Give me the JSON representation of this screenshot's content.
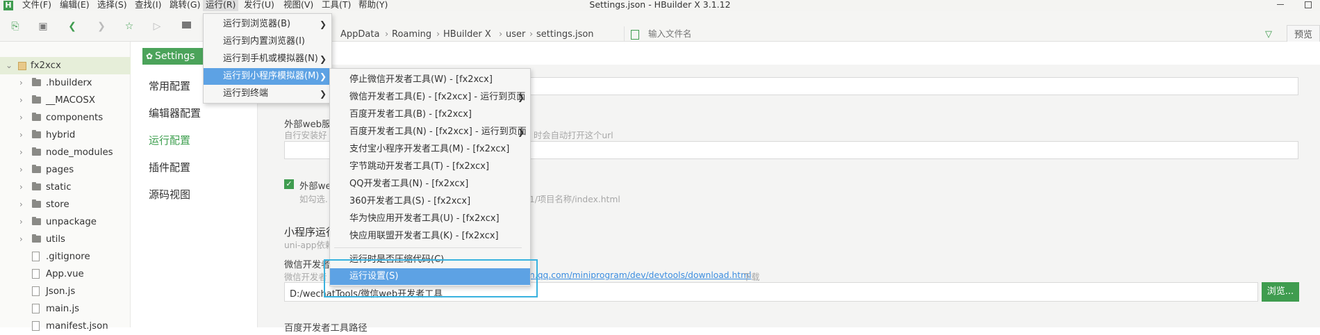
{
  "window": {
    "title": "Settings.json - HBuilder X 3.1.12",
    "app_icon": "H"
  },
  "menubar": [
    {
      "label": "文件(F)"
    },
    {
      "label": "编辑(E)"
    },
    {
      "label": "选择(S)"
    },
    {
      "label": "查找(I)"
    },
    {
      "label": "跳转(G)"
    },
    {
      "label": "运行(R)",
      "active": true
    },
    {
      "label": "发行(U)"
    },
    {
      "label": "视图(V)"
    },
    {
      "label": "工具(T)"
    },
    {
      "label": "帮助(Y)"
    }
  ],
  "window_controls": [
    "minimize-icon",
    "restore-icon"
  ],
  "toolbar": {
    "breadcrumb": [
      "AppData",
      "Roaming",
      "HBuilder X",
      "user",
      "settings.json"
    ],
    "file_search_placeholder": "输入文件名",
    "preview_label": "预览"
  },
  "sidebar": {
    "root": "fx2xcx",
    "items": [
      {
        "label": ".hbuilderx",
        "type": "folder"
      },
      {
        "label": "__MACOSX",
        "type": "folder"
      },
      {
        "label": "components",
        "type": "folder"
      },
      {
        "label": "hybrid",
        "type": "folder"
      },
      {
        "label": "node_modules",
        "type": "folder"
      },
      {
        "label": "pages",
        "type": "folder"
      },
      {
        "label": "static",
        "type": "folder"
      },
      {
        "label": "store",
        "type": "folder"
      },
      {
        "label": "unpackage",
        "type": "folder"
      },
      {
        "label": "utils",
        "type": "folder"
      },
      {
        "label": ".gitignore",
        "type": "file"
      },
      {
        "label": "App.vue",
        "type": "file"
      },
      {
        "label": "Json.js",
        "type": "file"
      },
      {
        "label": "main.js",
        "type": "file"
      },
      {
        "label": "manifest.json",
        "type": "file"
      }
    ]
  },
  "settings": {
    "tab_label": "Settings",
    "nav": [
      {
        "label": "常用配置"
      },
      {
        "label": "编辑器配置"
      },
      {
        "label": "运行配置",
        "active": true
      },
      {
        "label": "插件配置"
      },
      {
        "label": "源码视图"
      }
    ],
    "external_web_label": "外部web服务",
    "external_web_hint_left": "自行安装好",
    "external_web_hint_right": "时会自动打开这个url",
    "external_web_check_label": "外部we",
    "external_web_check_hint_left": "如勾选.",
    "external_web_check_hint_right": ".1/项目名称/index.html",
    "mp_section_title": "小程序运行",
    "mp_section_hint": "uni-app依赖",
    "wechat_label": "微信开发者",
    "wechat_hint_left": "微信开发者",
    "wechat_hint_link": "n.qq.com/miniprogram/dev/devtools/download.html",
    "wechat_hint_right": "下载",
    "wechat_path_value": "D:/wechatTools/微信web开发者工具",
    "browse_label": "浏览...",
    "baidu_label": "百度开发者工具路径"
  },
  "run_menu": [
    {
      "label": "运行到浏览器(B)",
      "submenu": true
    },
    {
      "label": "运行到内置浏览器(I)",
      "submenu": false
    },
    {
      "label": "运行到手机或模拟器(N)",
      "submenu": true
    },
    {
      "label": "运行到小程序模拟器(M)",
      "submenu": true,
      "highlighted": true
    },
    {
      "label": "运行到终端",
      "submenu": true
    }
  ],
  "mp_submenu": [
    {
      "label": "停止微信开发者工具(W) - [fx2xcx]",
      "submenu": false
    },
    {
      "label": "微信开发者工具(E) - [fx2xcx] - 运行到页面",
      "submenu": true
    },
    {
      "label": "百度开发者工具(B) - [fx2xcx]",
      "submenu": false
    },
    {
      "label": "百度开发者工具(N) - [fx2xcx] - 运行到页面",
      "submenu": true
    },
    {
      "label": "支付宝小程序开发者工具(M) - [fx2xcx]",
      "submenu": false
    },
    {
      "label": "字节跳动开发者工具(T) - [fx2xcx]",
      "submenu": false
    },
    {
      "label": "QQ开发者工具(N) - [fx2xcx]",
      "submenu": false
    },
    {
      "label": "360开发者工具(S) - [fx2xcx]",
      "submenu": false
    },
    {
      "label": "华为快应用开发者工具(U) - [fx2xcx]",
      "submenu": false
    },
    {
      "label": "快应用联盟开发者工具(K) - [fx2xcx]",
      "submenu": false
    }
  ],
  "mp_submenu_footer": [
    {
      "label": "运行时是否压缩代码(C)",
      "highlighted": false
    },
    {
      "label": "运行设置(S)",
      "highlighted": true
    }
  ],
  "colors": {
    "accent_green": "#3f9c4f",
    "menu_highlight": "#5da2e4",
    "annotation_box": "#39b2df"
  }
}
